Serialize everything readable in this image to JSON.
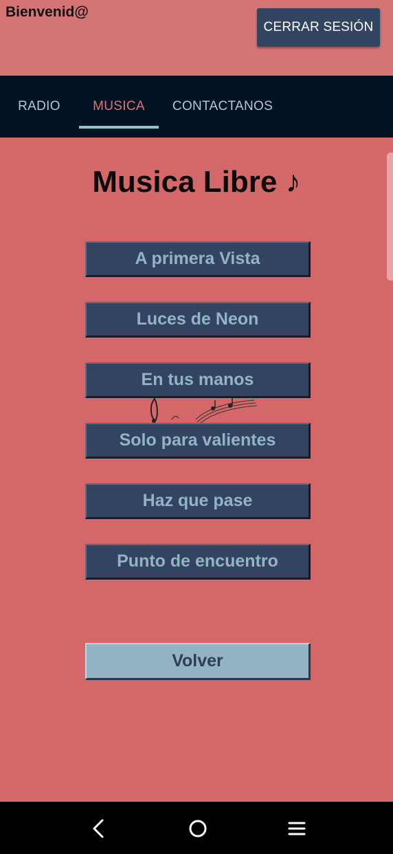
{
  "header": {
    "welcome": "Bienvenid@",
    "logout_label": "CERRAR SESIÓN"
  },
  "nav": {
    "tabs": [
      {
        "label": "RADIO",
        "active": false
      },
      {
        "label": "MUSICA",
        "active": true
      },
      {
        "label": "CONTACTANOS",
        "active": false
      }
    ]
  },
  "main": {
    "title": "Musica Libre ♪",
    "songs": [
      "A primera Vista",
      "Luces de Neon",
      "En tus manos",
      "Solo para valientes",
      "Haz que pase",
      "Punto de encuentro"
    ],
    "back_label": "Volver"
  },
  "system_nav": {
    "icons": [
      "back-icon",
      "home-icon",
      "menu-icon"
    ]
  },
  "colors": {
    "background": "#d46868",
    "nav": "#021324",
    "button": "#32445f",
    "button_text": "#93b3c8",
    "active_tab": "#e07474",
    "back_button": "#93b2c3"
  }
}
